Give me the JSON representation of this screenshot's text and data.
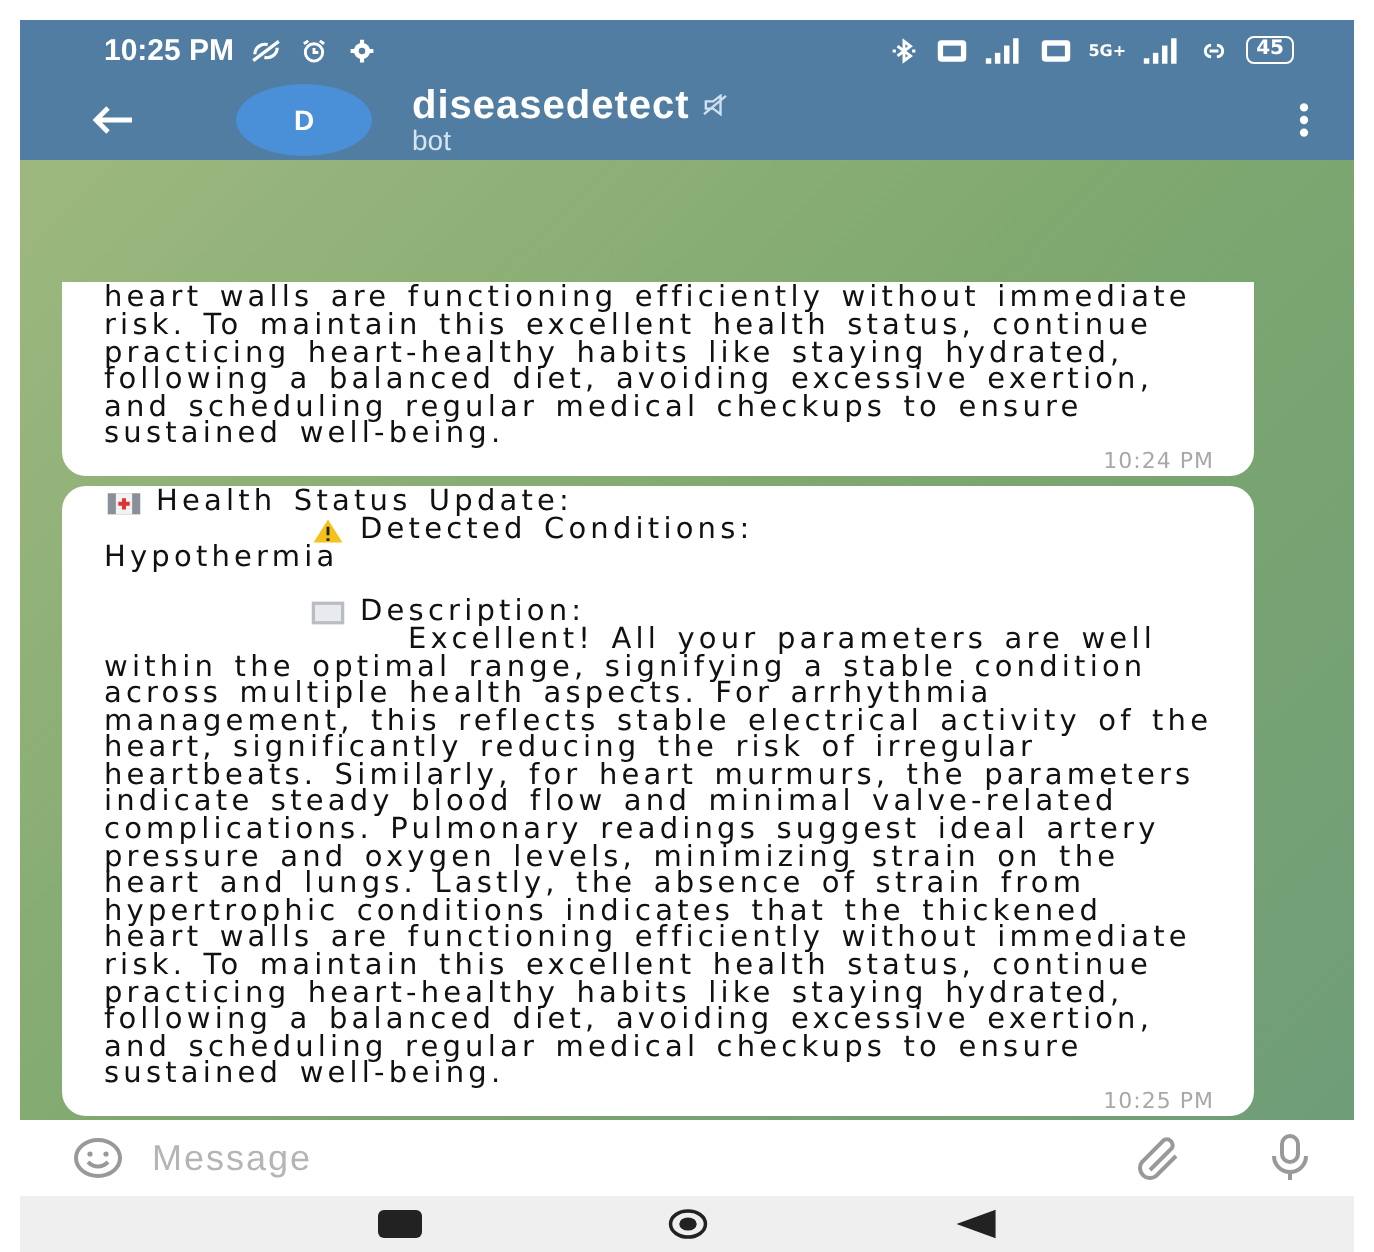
{
  "status_bar": {
    "time": "10:25 PM",
    "network": "5G+",
    "battery": "45"
  },
  "header": {
    "avatar_letter": "D",
    "name": "diseasedetect",
    "muted": true,
    "subtitle": "bot"
  },
  "messages": [
    {
      "kind": "text",
      "text": "heart walls are functioning efficiently without immediate risk. To maintain this excellent health status, continue practicing heart-healthy habits like staying hydrated, following a balanced diet, avoiding excessive exertion, and scheduling regular medical checkups to ensure sustained well-being.",
      "time": "10:24 PM"
    },
    {
      "kind": "report",
      "title": "Health Status Update:",
      "conditions_label": "Detected Conditions:",
      "condition": "Hypothermia",
      "description_label": "Description:",
      "description": "Excellent! All your parameters are well within the optimal range, signifying a stable condition across multiple health aspects. For arrhythmia management, this reflects stable electrical activity of the heart, significantly reducing the risk of irregular heartbeats. Similarly, for heart murmurs, the parameters indicate steady blood flow and minimal valve-related complications. Pulmonary readings suggest ideal artery pressure and oxygen levels, minimizing strain on the heart and lungs. Lastly, the absence of strain from hypertrophic conditions indicates that the thickened heart walls are functioning efficiently without immediate risk. To maintain this excellent health status, continue practicing heart-healthy habits like staying hydrated, following a balanced diet, avoiding excessive exertion, and scheduling regular medical checkups to ensure sustained well-being.",
      "time": "10:25 PM"
    }
  ],
  "composer": {
    "placeholder": "Message"
  }
}
